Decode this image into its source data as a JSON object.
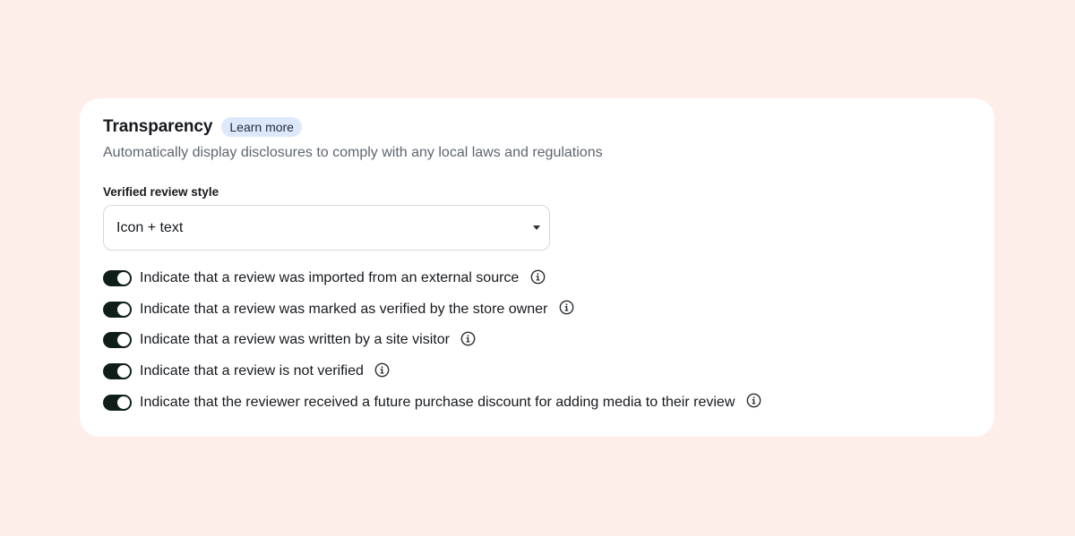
{
  "section": {
    "title": "Transparency",
    "learn_more": "Learn more",
    "subtitle": "Automatically display disclosures to comply with any local laws and regulations"
  },
  "verified_style": {
    "label": "Verified review style",
    "selected": "Icon + text"
  },
  "toggles": [
    {
      "label": "Indicate that a review was imported from an external source",
      "on": true,
      "icon": "info-icon"
    },
    {
      "label": "Indicate that a review was marked as verified by the store owner",
      "on": true,
      "icon": "info-icon"
    },
    {
      "label": "Indicate that a review was written by a site visitor",
      "on": true,
      "icon": "info-icon"
    },
    {
      "label": "Indicate that a review is not verified",
      "on": true,
      "icon": "info-icon"
    },
    {
      "label": "Indicate that the reviewer received a future purchase discount for adding media to their review",
      "on": true,
      "icon": "info-icon"
    }
  ],
  "colors": {
    "page_background": "#fdeeea",
    "card_background": "#ffffff",
    "toggle_on": "#0f1f17",
    "badge_background": "#dde9fb"
  }
}
